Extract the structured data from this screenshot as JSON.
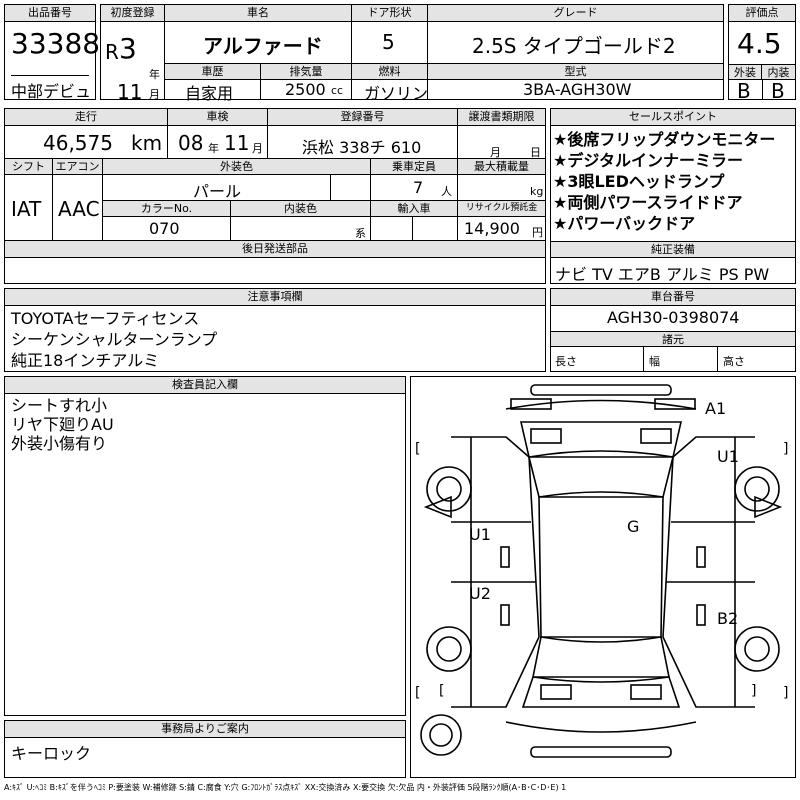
{
  "lot": {
    "label": "出品番号",
    "number": "33388",
    "debut": "中部デビュ"
  },
  "first_reg": {
    "label": "初度登録",
    "era": "R",
    "year": "3",
    "year_unit": "年",
    "month": "11",
    "month_unit": "月"
  },
  "car_name": {
    "label": "車名",
    "value": "アルファード"
  },
  "door": {
    "label": "ドア形状",
    "value": "5"
  },
  "grade": {
    "label": "グレード",
    "value": "2.5S タイプゴールド2"
  },
  "score": {
    "label": "評価点",
    "value": "4.5",
    "ext_label": "外装",
    "int_label": "内装",
    "ext": "B",
    "int": "B"
  },
  "history": {
    "label": "車歴",
    "value": "自家用"
  },
  "displacement": {
    "label": "排気量",
    "value": "2500",
    "unit": "cc"
  },
  "fuel": {
    "label": "燃料",
    "value": "ガソリン"
  },
  "model": {
    "label": "型式",
    "value": "3BA-AGH30W"
  },
  "mileage": {
    "label": "走行",
    "value": "46,575",
    "unit": "km"
  },
  "inspection": {
    "label": "車検",
    "year": "08",
    "year_unit": "年",
    "month": "11",
    "month_unit": "月"
  },
  "plate": {
    "label": "登録番号",
    "value": "浜松 338チ 610"
  },
  "transfer": {
    "label": "譲渡書類期限",
    "month_unit": "月",
    "day_unit": "日"
  },
  "selling": {
    "label": "セールスポイント",
    "items": [
      "★後席フリップダウンモニター",
      "★デジタルインナーミラー",
      "★3眼LEDヘッドランプ",
      "★両側パワースライドドア",
      "★パワーバックドア"
    ]
  },
  "shift": {
    "label": "シフト",
    "value": "IAT"
  },
  "aircon": {
    "label": "エアコン",
    "value": "AAC"
  },
  "ext_color": {
    "label": "外装色",
    "value": "パール"
  },
  "capacity": {
    "label": "乗車定員",
    "value": "7",
    "unit": "人"
  },
  "max_load": {
    "label": "最大積載量",
    "unit": "kg"
  },
  "color_no": {
    "label": "カラーNo.",
    "value": "070"
  },
  "int_color": {
    "label": "内装色",
    "unit": "系"
  },
  "import": {
    "label": "輸入車"
  },
  "recycle": {
    "label": "リサイクル預託金",
    "value": "14,900",
    "unit": "円"
  },
  "later_parts": {
    "label": "後日発送部品"
  },
  "equipment": {
    "label": "純正装備",
    "value": "ナビ TV エアB アルミ PS PW"
  },
  "notes": {
    "label": "注意事項欄",
    "lines": [
      "TOYOTAセーフティセンス",
      "シーケンシャルターンランプ",
      "純正18インチアルミ"
    ]
  },
  "chassis": {
    "label": "車台番号",
    "value": "AGH30-0398074"
  },
  "dims": {
    "label": "諸元",
    "length": "長さ",
    "width": "幅",
    "height": "高さ"
  },
  "inspector": {
    "label": "検査員記入欄",
    "lines": [
      "シートすれ小",
      "リヤ下廻りAU",
      "外装小傷有り"
    ]
  },
  "office": {
    "label": "事務局よりご案内",
    "value": "キーロック"
  },
  "diagram_marks": {
    "a1": "A1",
    "u1_right": "U1",
    "g": "G",
    "u1_left": "U1",
    "u2": "U2",
    "b2": "B2"
  },
  "legend": "A:ｷｽﾞ U:ﾍｺﾐ B:ｷｽﾞを伴うﾍｺﾐ P:要塗装 W:補修跡 S:錆 C:腐食 Y:穴 G:ﾌﾛﾝﾄｶﾞﾗｽ点ｷｽﾞ XX:交換済み X:要交換 欠:欠品 内・外装評価 5段階ﾗﾝｸ順(A･B･C･D･E) 1"
}
